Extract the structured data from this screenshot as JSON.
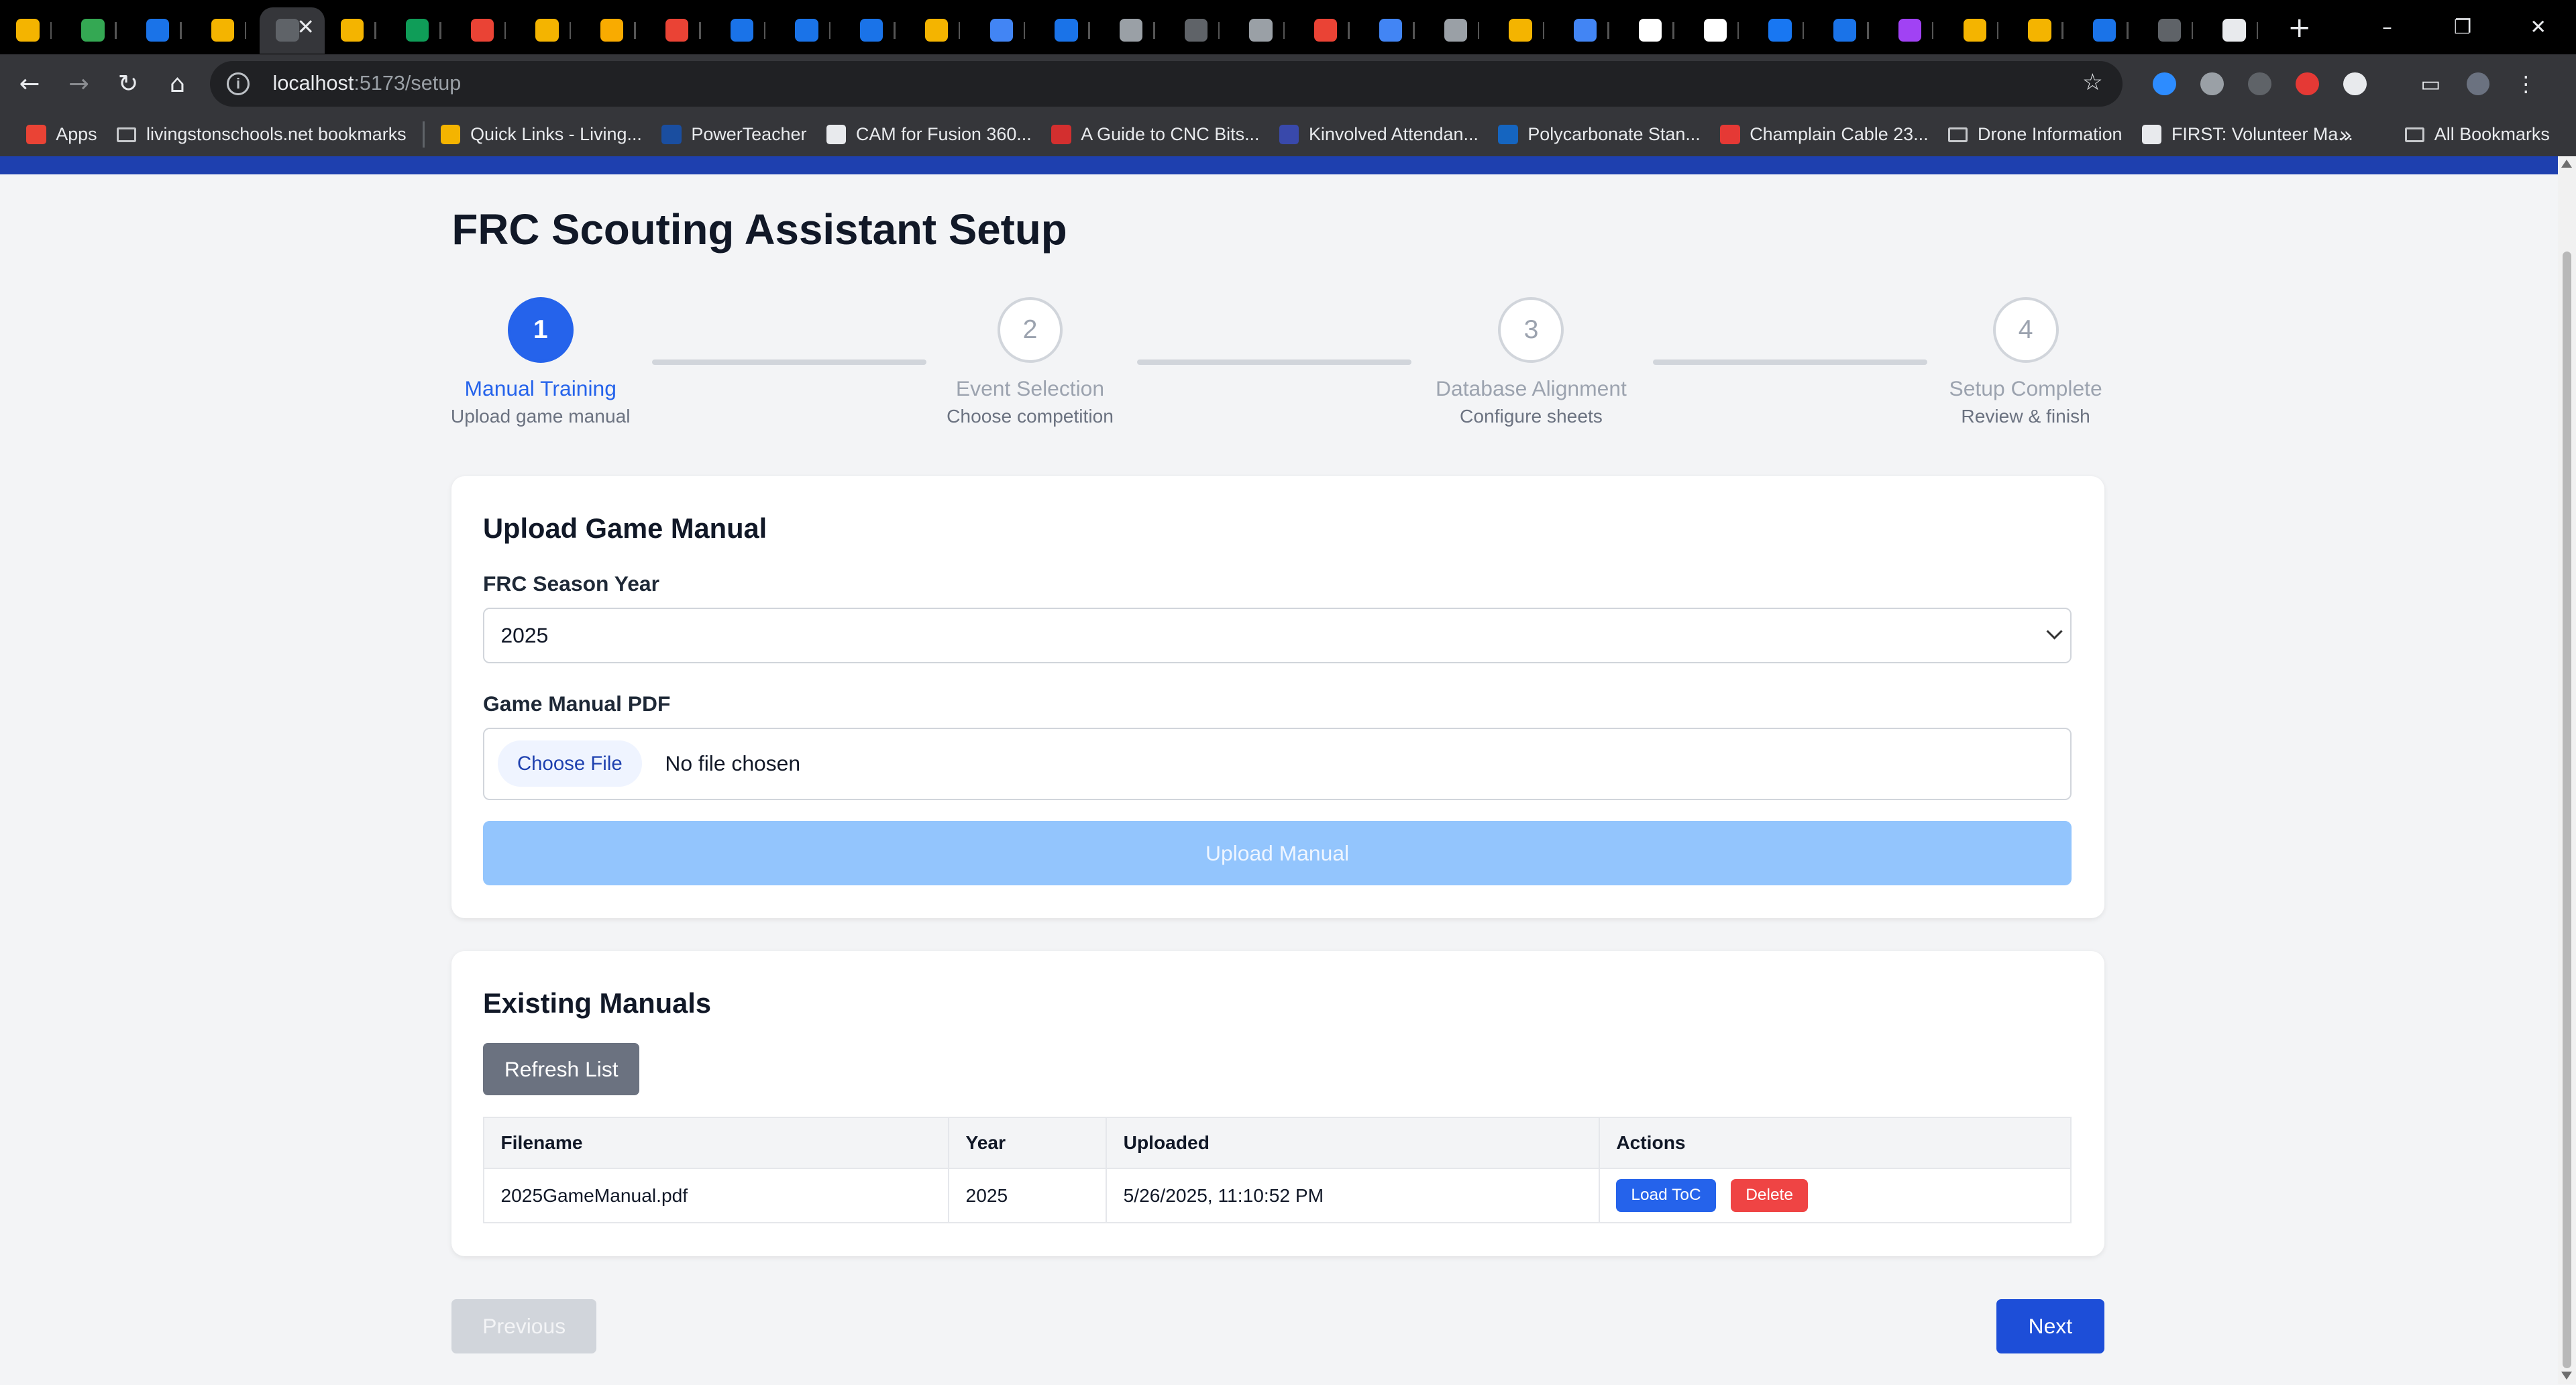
{
  "browser": {
    "tab_favicon_colors": [
      "#f4b400",
      "#34a853",
      "#1a73e8",
      "#f4b400",
      "#5f6368",
      "#f4b400",
      "#0f9d58",
      "#ea4335",
      "#f4b400",
      "#f9ab00",
      "#ea4335",
      "#1a73e8",
      "#1a73e8",
      "#1a73e8",
      "#f4b400",
      "#4285f4",
      "#1a73e8",
      "#9aa0a6",
      "#5f6368",
      "#9aa0a6",
      "#ea4335",
      "#4285f4",
      "#9aa0a6",
      "#f4b400",
      "#4285f4",
      "#ffffff",
      "#ffffff",
      "#1877f2",
      "#1a73e8",
      "#a142f4",
      "#f4b400",
      "#f4b400",
      "#1a73e8",
      "#5f6368",
      "#e8eaed"
    ],
    "active_tab_index": 4,
    "new_tab_label": "+",
    "window_controls": [
      "–",
      "❐",
      "✕"
    ],
    "url_host": "localhost",
    "url_path": ":5173/setup",
    "extensions": [
      {
        "name": "zoom-icon",
        "color": "#2d8cff"
      },
      {
        "name": "zotero-icon",
        "color": "#9aa0a6"
      },
      {
        "name": "reader-icon",
        "color": "#5f6368"
      },
      {
        "name": "adblock-icon",
        "color": "#e53935"
      },
      {
        "name": "puzzle-icon",
        "color": "#e8eaed"
      }
    ]
  },
  "bookmarks": {
    "items": [
      {
        "label": "Apps",
        "icon_color": "#ea4335"
      },
      {
        "label": "livingstonschools.net bookmarks",
        "folder": true
      },
      {
        "label": "Quick Links - Living...",
        "icon_color": "#f4b400"
      },
      {
        "label": "PowerTeacher",
        "icon_color": "#1a4ea0"
      },
      {
        "label": "CAM for Fusion 360...",
        "icon_color": "#e8eaed"
      },
      {
        "label": "A Guide to CNC Bits...",
        "icon_color": "#d32f2f"
      },
      {
        "label": "Kinvolved Attendan...",
        "icon_color": "#3949ab"
      },
      {
        "label": "Polycarbonate Stan...",
        "icon_color": "#1565c0"
      },
      {
        "label": "Champlain Cable 23...",
        "icon_color": "#e53935"
      },
      {
        "label": "Drone Information",
        "folder": true
      },
      {
        "label": "FIRST: Volunteer Ma...",
        "icon_color": "#e8eaed"
      }
    ],
    "all_bookmarks": "All Bookmarks",
    "overflow": "»"
  },
  "page": {
    "title": "FRC Scouting Assistant Setup",
    "steps": [
      {
        "number": "1",
        "label": "Manual Training",
        "sub": "Upload game manual"
      },
      {
        "number": "2",
        "label": "Event Selection",
        "sub": "Choose competition"
      },
      {
        "number": "3",
        "label": "Database Alignment",
        "sub": "Configure sheets"
      },
      {
        "number": "4",
        "label": "Setup Complete",
        "sub": "Review & finish"
      }
    ],
    "upload_card": {
      "heading": "Upload Game Manual",
      "year_label": "FRC Season Year",
      "year_value": "2025",
      "pdf_label": "Game Manual PDF",
      "choose_file": "Choose File",
      "no_file": "No file chosen",
      "upload_button": "Upload Manual"
    },
    "manuals_card": {
      "heading": "Existing Manuals",
      "refresh_button": "Refresh List",
      "columns": [
        "Filename",
        "Year",
        "Uploaded",
        "Actions"
      ],
      "rows": [
        {
          "filename": "2025GameManual.pdf",
          "year": "2025",
          "uploaded": "5/26/2025, 11:10:52 PM",
          "load": "Load ToC",
          "delete": "Delete"
        }
      ]
    },
    "nav": {
      "previous": "Previous",
      "next": "Next"
    }
  }
}
